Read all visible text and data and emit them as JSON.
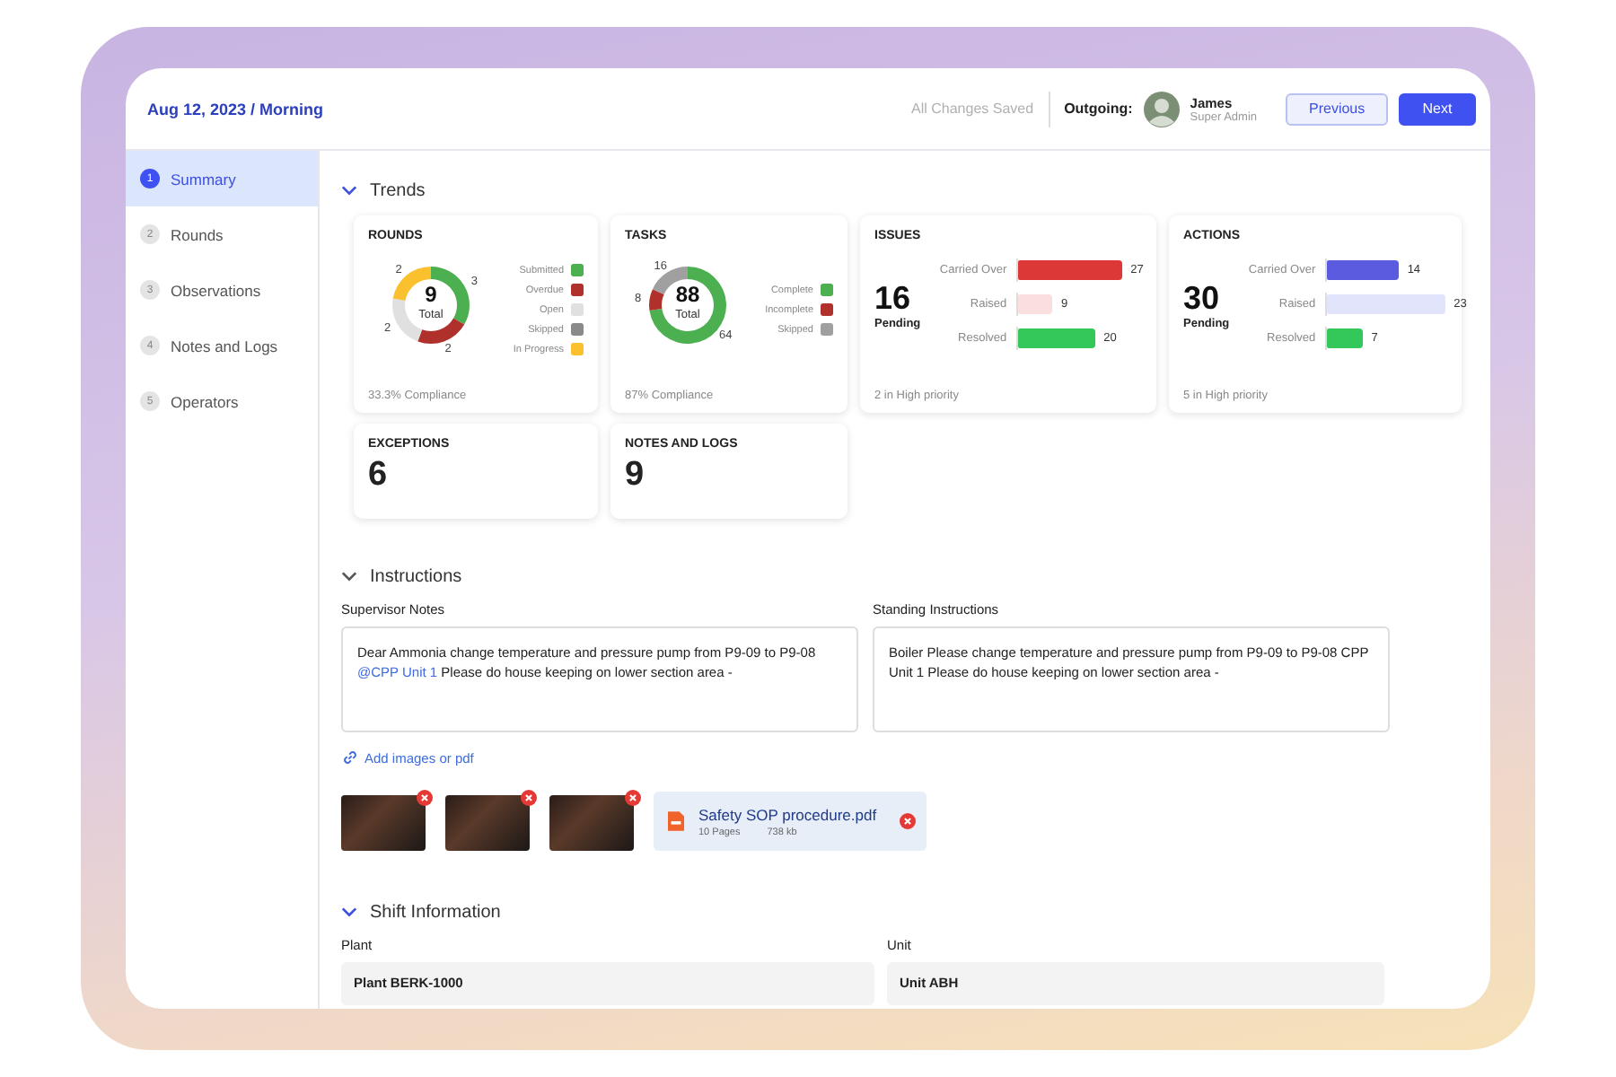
{
  "header": {
    "date_shift": "Aug 12, 2023 / Morning",
    "save_status": "All Changes Saved",
    "outgoing_label": "Outgoing:",
    "user": {
      "name": "James",
      "role": "Super Admin"
    },
    "buttons": [
      {
        "label": "Previous",
        "kind": "secondary"
      },
      {
        "label": "Next",
        "kind": "primary"
      }
    ]
  },
  "sidebar": {
    "items": [
      {
        "number": "1",
        "label": "Summary",
        "selected": true
      },
      {
        "number": "2",
        "label": "Rounds",
        "selected": false
      },
      {
        "number": "3",
        "label": "Observations",
        "selected": false
      },
      {
        "number": "4",
        "label": "Notes and Logs",
        "selected": false
      },
      {
        "number": "5",
        "label": "Operators",
        "selected": false
      }
    ]
  },
  "trends": {
    "title": "Trends",
    "expanded": true,
    "cards": [
      {
        "kind": "donut",
        "title": "ROUNDS",
        "center_value": "9",
        "center_label": "Total",
        "footer": "33.3% Compliance",
        "legend": [
          {
            "color": "#4caf50"
          },
          {
            "color": "#b0302b"
          },
          {
            "color": "#e0e0e0"
          },
          {
            "color": "#8a8a8a"
          },
          {
            "color": "#fbc02d"
          }
        ],
        "chart_data": {
          "type": "donut",
          "categories": [
            "Submitted",
            "Overdue",
            "Open",
            "Skipped",
            "In Progress"
          ],
          "values": [
            3,
            2,
            2,
            0,
            2
          ],
          "value_labels": [
            "3",
            "2",
            "2",
            null,
            "2"
          ]
        }
      },
      {
        "kind": "donut",
        "title": "TASKS",
        "center_value": "88",
        "center_label": "Total",
        "footer": "87% Compliance",
        "legend": [
          {
            "color": "#4caf50"
          },
          {
            "color": "#b0302b"
          },
          {
            "color": "#a0a0a0"
          }
        ],
        "chart_data": {
          "type": "donut",
          "categories": [
            "Complete",
            "Incomplete",
            "Skipped"
          ],
          "values": [
            64,
            8,
            16
          ],
          "value_labels": [
            "64",
            "8",
            "16"
          ]
        }
      },
      {
        "kind": "bar",
        "title": "ISSUES",
        "big_value": "16",
        "big_label": "Pending",
        "footer": "2 in High priority",
        "bars": [
          {
            "color": "#dc3838"
          },
          {
            "color": "#fbdede"
          },
          {
            "color": "#34c759"
          }
        ],
        "chart_data": {
          "type": "bar",
          "orientation": "horizontal",
          "categories": [
            "Carried Over",
            "Raised",
            "Resolved"
          ],
          "values": [
            27,
            9,
            20
          ],
          "value_labels": [
            "27",
            "9",
            "20"
          ]
        }
      },
      {
        "kind": "bar",
        "title": "ACTIONS",
        "big_value": "30",
        "big_label": "Pending",
        "footer": "5 in High priority",
        "bars": [
          {
            "color": "#5b5be0"
          },
          {
            "color": "#e2e4fb"
          },
          {
            "color": "#34c759"
          }
        ],
        "chart_data": {
          "type": "bar",
          "orientation": "horizontal",
          "categories": [
            "Carried Over",
            "Raised",
            "Resolved"
          ],
          "values": [
            14,
            23,
            7
          ],
          "value_labels": [
            "14",
            "23",
            "7"
          ]
        }
      },
      {
        "kind": "count",
        "title": "EXCEPTIONS",
        "value": "6"
      },
      {
        "kind": "count",
        "title": "NOTES AND LOGS",
        "value": "9"
      }
    ]
  },
  "instructions": {
    "title": "Instructions",
    "expanded": true,
    "fields": [
      {
        "label": "Supervisor Notes",
        "segments": [
          {
            "kind": "text",
            "text": "Dear Ammonia change temperature and pressure pump from P9-09 to P9-08"
          },
          {
            "kind": "mention",
            "text": "@CPP Unit 1"
          },
          {
            "kind": "text",
            "text": "Please do house keeping on lower section area -"
          }
        ]
      },
      {
        "label": "Standing Instructions",
        "segments": [
          {
            "kind": "text",
            "text": "Boiler Please change temperature and pressure pump from P9-09 to P9-08 CPP Unit 1 Please do house keeping on lower section area -"
          }
        ]
      }
    ],
    "add_link": "Add images or pdf",
    "attachments": [
      {
        "kind": "image"
      },
      {
        "kind": "image"
      },
      {
        "kind": "image"
      },
      {
        "kind": "pdf",
        "name": "Safety SOP procedure.pdf",
        "pages": "10 Pages",
        "size": "738 kb"
      }
    ]
  },
  "shift_information": {
    "title": "Shift Information",
    "expanded": true,
    "fields": [
      {
        "label": "Plant",
        "value": "Plant BERK-1000"
      },
      {
        "label": "Unit",
        "value": "Unit ABH"
      }
    ]
  }
}
